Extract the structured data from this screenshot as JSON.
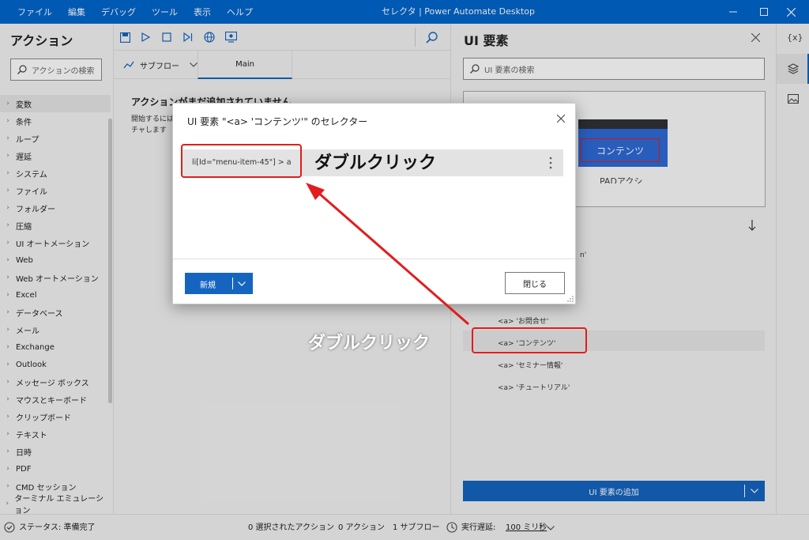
{
  "window": {
    "title": "セレクタ | Power Automate Desktop",
    "menu": [
      "ファイル",
      "編集",
      "デバッグ",
      "ツール",
      "表示",
      "ヘルプ"
    ]
  },
  "actions_pane": {
    "title": "アクション",
    "search_placeholder": "アクションの検索",
    "categories": [
      "変数",
      "条件",
      "ループ",
      "遅延",
      "システム",
      "ファイル",
      "フォルダー",
      "圧縮",
      "UI オートメーション",
      "Web",
      "Web オートメーション",
      "Excel",
      "データベース",
      "メール",
      "Exchange",
      "Outlook",
      "メッセージ ボックス",
      "マウスとキーボード",
      "クリップボード",
      "テキスト",
      "日時",
      "PDF",
      "CMD セッション",
      "ターミナル エミュレーション"
    ]
  },
  "designer": {
    "subflow_label": "サブフロー",
    "tab_main": "Main",
    "empty_title": "アクションがまだ追加されていません",
    "empty_text_1": "開始するには",
    "empty_text_2": "チャします"
  },
  "ui_elements_pane": {
    "title": "UI 要素",
    "search_placeholder": "UI 要素の検索",
    "preview_text_1": "コンテンツ",
    "preview_text_2": "PADアクシ",
    "items": [
      "n'",
      "<a> 'お問合せ'",
      "<a> 'コンテンツ'",
      "<a> 'セミナー情報'",
      "<a> 'チュートリアル'"
    ],
    "add_button": "UI 要素の追加"
  },
  "dialog": {
    "title": "UI 要素 \"<a> 'コンテンツ'\" のセレクター",
    "selector": "li[Id=\"menu-item-45\"] > a",
    "new_button": "新規",
    "close_button": "閉じる"
  },
  "annotations": {
    "callout_top": "ダブルクリック",
    "callout_bottom": "ダブルクリック",
    "color": "#e31c1c"
  },
  "status_bar": {
    "status": "ステータス: 準備完了",
    "selected": "0 選択されたアクション",
    "actions": "0 アクション",
    "subflows": "1 サブフロー",
    "delay_label": "実行遅延:",
    "delay_value": "100 ミリ秒"
  }
}
